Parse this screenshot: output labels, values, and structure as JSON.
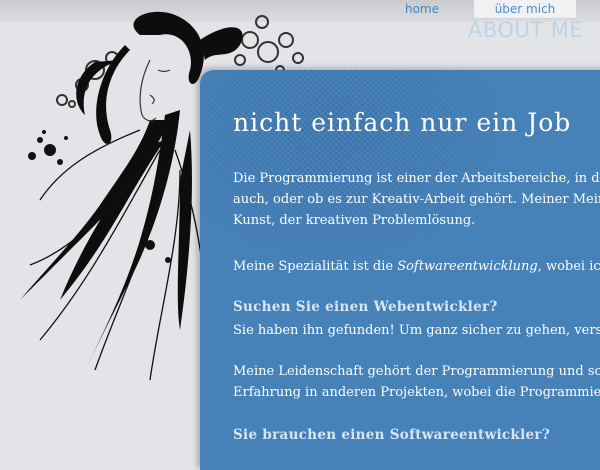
{
  "nav": {
    "home_label": "home",
    "about_label": "über mich"
  },
  "header": {
    "section_title": "ABOUT ME"
  },
  "content": {
    "title": "nicht einfach nur ein Job",
    "para1_line1": "Die Programmierung ist einer der Arbeitsbereiche, in dem",
    "para1_line2": "auch, oder ob es zur Kreativ-Arbeit gehört. Meiner Meinu",
    "para1_line3": "Kunst, der kreativen Problemlösung.",
    "para2_prefix": "Meine Spezialität ist die ",
    "para2_emph": "Softwareentwicklung",
    "para2_suffix": ", wobei ich",
    "subhead1": "Suchen Sie einen Webentwickler?",
    "para3_line1": "Sie haben ihn gefunden! Um ganz sicher zu gehen, versch",
    "para4_line1": "Meine Leidenschaft gehört der Programmierung und somi",
    "para4_line2": "Erfahrung in anderen Projekten, wobei die Programmiersp",
    "subhead2": "Sie brauchen einen Softwareentwickler?"
  },
  "colors": {
    "panel": "#4681b8",
    "nav_link": "#3d86c6",
    "background": "#e3e4e7"
  }
}
